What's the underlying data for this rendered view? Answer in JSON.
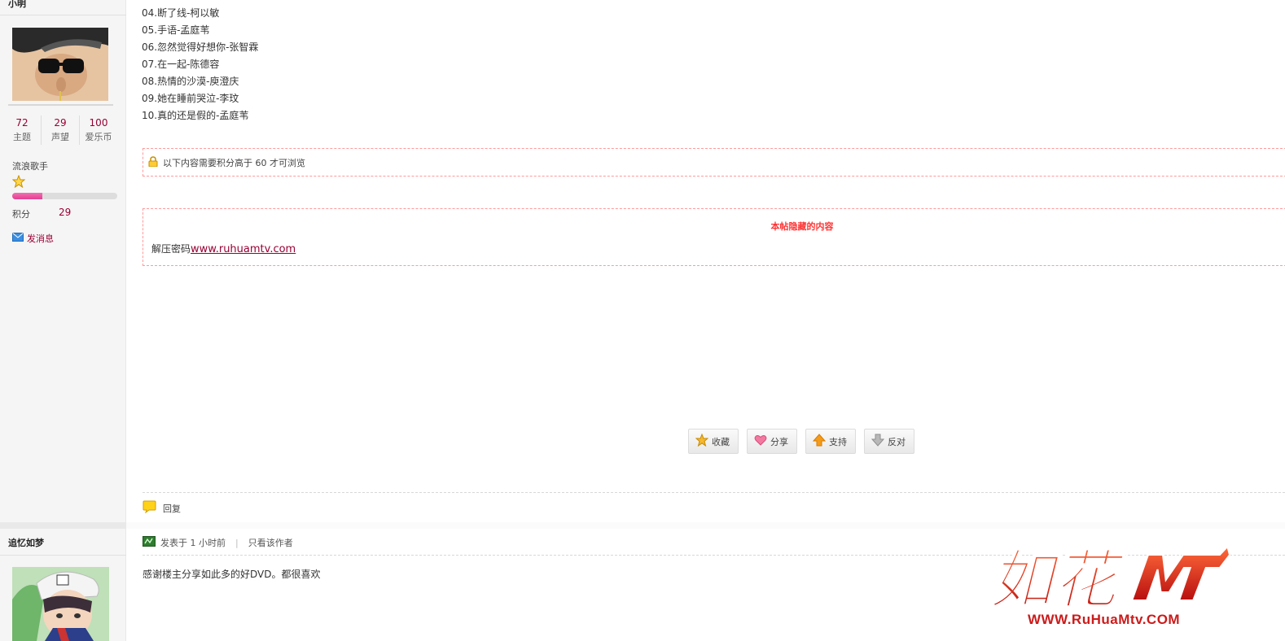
{
  "sidebar": {
    "user1": {
      "name": "小明",
      "stats": [
        {
          "value": "72",
          "label": "主题"
        },
        {
          "value": "29",
          "label": "声望"
        },
        {
          "value": "100",
          "label": "爱乐币"
        }
      ],
      "rank": "流浪歌手",
      "points_label": "积分",
      "points_value": "29",
      "progress_fraction": 0.29,
      "send_message": "发消息"
    },
    "user2": {
      "name": "追忆如梦"
    }
  },
  "post": {
    "songs": [
      "04.断了线-柯以敏",
      "05.手语-孟庭苇",
      "06.忽然觉得好想你-张智霖",
      "07.在一起-陈德容",
      "08.热情的沙漠-庾澄庆",
      "09.她在睡前哭泣-李玟",
      "10.真的还是假的-孟庭苇"
    ],
    "locked_notice": "以下内容需要积分高于 60 才可浏览",
    "hidden": {
      "title": "本帖隐藏的内容",
      "prefix": "解压密码",
      "link": "www.ruhuamtv.com"
    },
    "actions": [
      {
        "label": "收藏",
        "icon": "star-icon"
      },
      {
        "label": "分享",
        "icon": "heart-icon"
      },
      {
        "label": "支持",
        "icon": "arrow-up-icon"
      },
      {
        "label": "反对",
        "icon": "arrow-down-icon"
      }
    ],
    "reply_label": "回复"
  },
  "reply_post": {
    "posted": "发表于 1 小时前",
    "only_author": "只看该作者",
    "content": "感谢楼主分享如此多的好DVD。都很喜欢"
  },
  "watermark": {
    "text": "如花",
    "url": "WWW.RuHuaMtv.COM"
  },
  "colors": {
    "accent": "#990033",
    "hidden_title": "#ff3333",
    "dashed_border": "#ff9a9a",
    "logo_red": "#cc1b1b"
  }
}
